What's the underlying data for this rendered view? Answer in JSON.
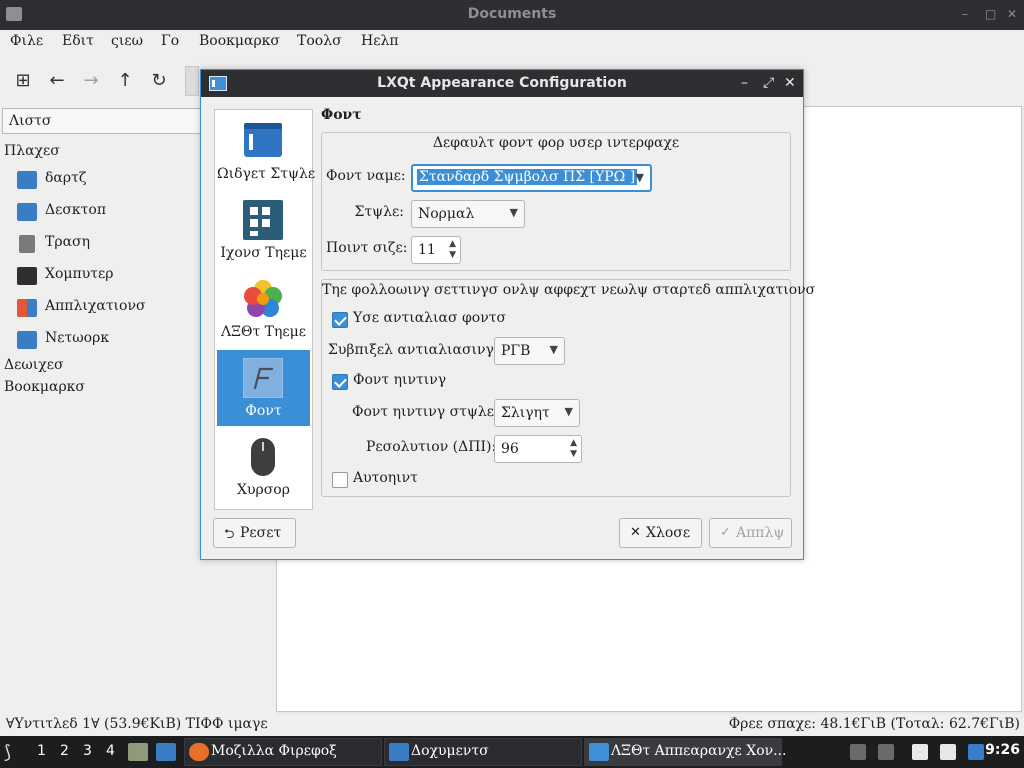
{
  "file_manager": {
    "title": "Documents",
    "menu": [
      "Φιλε",
      "Εδιτ",
      "ςιεω",
      "Γο",
      "Βοοκμαρκσ",
      "Τοολσ",
      "Ηελπ"
    ],
    "side_combo": "Λιστσ",
    "places_header": "Πλαχεσ",
    "places": [
      {
        "label": "δαρτζ",
        "icon": "home-folder-icon",
        "color": "#3b7dc4"
      },
      {
        "label": "Δεσκτοπ",
        "icon": "desktop-icon",
        "color": "#3b7dc4"
      },
      {
        "label": "Τραση",
        "icon": "trash-icon",
        "color": "#7a7a7a"
      },
      {
        "label": "Χομπυτερ",
        "icon": "computer-icon",
        "color": "#2f2f2f"
      },
      {
        "label": "Αππλιχατιονσ",
        "icon": "applications-icon",
        "color": "#e0573a"
      },
      {
        "label": "Νετωορκ",
        "icon": "network-icon",
        "color": "#3b7dc4"
      }
    ],
    "devices_header": "Δεωιχεσ",
    "bookmarks_header": "Βοοκμαρκσ",
    "status_left": "∀Υντιτλεδ 1∀ (53.9€ΚιΒ) ΤΙΦΦ ιμαγε",
    "status_right": "Φρεε σπαχε: 48.1€ΓιΒ (Τοταλ: 62.7€ΓιΒ)"
  },
  "dialog": {
    "title": "LXQt Appearance Configuration",
    "nav": [
      {
        "label": "Ωιδγετ Στψλε",
        "icon": "widget-style-icon",
        "selected": false
      },
      {
        "label": "Ιχονσ Τηεμε",
        "icon": "icons-theme-icon",
        "selected": false
      },
      {
        "label": "ΛΞΘτ Τηεμε",
        "icon": "lxqt-theme-icon",
        "selected": false
      },
      {
        "label": "Φοντ",
        "icon": "font-icon",
        "selected": true
      },
      {
        "label": "Χυρσορ",
        "icon": "cursor-icon",
        "selected": false
      }
    ],
    "heading": "Φοντ",
    "default_group": {
      "title": "Δεφαυλτ φοντ φορ υσερ ιντερφαχε",
      "font_name_label": "Φοντ ναμε:",
      "font_name_value": "Στανδαρδ Σψμβολσ ΠΣ [ΥΡΩ ]",
      "style_label": "Στψλε:",
      "style_value": "Νορμαλ",
      "size_label": "Ποιντ σιζε:",
      "size_value": "11"
    },
    "new_apps_group": {
      "title": "Τηε φολλοωινγ σεττινγσ ονλψ αφφεχτ νεωλψ σταρτεδ αππλιχατιονσ",
      "antialias_label": "Υσε αντιαλιασ φοντσ",
      "antialias_checked": true,
      "subpixel_label": "Συβπιξελ αντιαλιασινγ:",
      "subpixel_value": "ΡΓΒ",
      "hinting_label": "Φοντ ηιντινγ",
      "hinting_checked": true,
      "hint_style_label": "Φοντ ηιντινγ στψλε:",
      "hint_style_value": "Σλιγητ",
      "resolution_label": "Ρεσολυτιον (ΔΠΙ):",
      "resolution_value": "96",
      "autohint_label": "Αυτοηιντ",
      "autohint_checked": false
    },
    "buttons": {
      "reset": "Ρεσετ",
      "close": "Χλοσε",
      "apply": "Αππλψ"
    }
  },
  "taskbar": {
    "desktops": [
      "1",
      "2",
      "3",
      "4"
    ],
    "tasks": [
      {
        "label": "Μοζιλλα Φιρεφοξ",
        "icon": "firefox-icon",
        "color": "#e8702a"
      },
      {
        "label": "Δοχυμεντσ",
        "icon": "folder-icon",
        "color": "#3b7dc4"
      },
      {
        "label": "ΛΞΘτ Αππεαρανχε Χον...",
        "icon": "appearance-icon",
        "color": "#3f8fd9"
      }
    ],
    "clock": "9:26"
  }
}
